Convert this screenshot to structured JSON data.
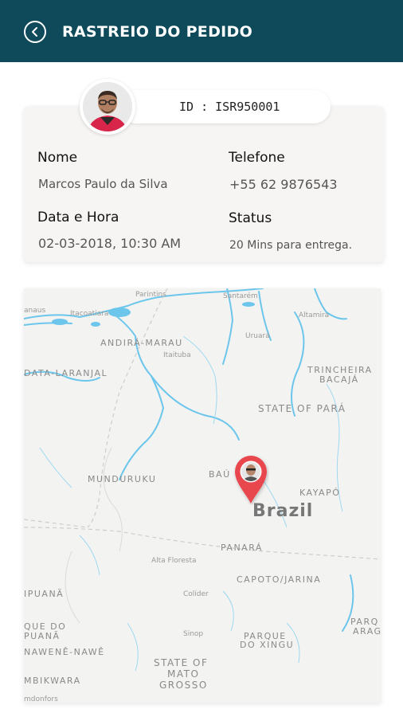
{
  "header": {
    "title": "RASTREIO DO PEDIDO"
  },
  "order": {
    "id_text": "ID : ISR950001"
  },
  "details": {
    "name_label": "Nome",
    "name_value": "Marcos Paulo da Silva",
    "phone_label": "Telefone",
    "phone_value": "+55 62 9876543",
    "datetime_label": "Data e Hora",
    "datetime_value": "02-03-2018, 10:30 AM",
    "status_label": "Status",
    "status_value": "20 Mins para entrega."
  },
  "map": {
    "labels": {
      "manaus": "anaus",
      "itacoatiara": "Itacoatiara",
      "parintins": "Parintins",
      "santarem": "Santarém",
      "altamira": "Altamira",
      "andira_marau": "ANDIRÁ-MARAU",
      "itaituba": "Itaituba",
      "uruara": "Uruará",
      "data_laranjal": "DATA-LARANJAL",
      "trincheira_bacaja_1": "TRINCHEIRA",
      "trincheira_bacaja_2": "BACAJÁ",
      "state_of_para": "STATE OF PARÁ",
      "munduruku": "MUNDURUKU",
      "bau": "BAÚ",
      "kayapo": "KAYAPÓ",
      "brazil": "Brazil",
      "panara": "PANARÁ",
      "alta_floresta": "Alta Floresta",
      "capoto_jarina": "CAPOTO/JARINA",
      "ipuana": "IPUANÃ",
      "colider": "Colíder",
      "que_do_1": "QUE DO",
      "que_do_2": "PUANÃ",
      "sinop": "Sinop",
      "parque_xingu_1": "PARQUE",
      "parque_xingu_2": "DO XINGU",
      "parq_arag_1": "PARQ",
      "parq_arag_2": "ARAG",
      "nawene_nawe": "NAWENÊ-NAWÊ",
      "state_of_mato_grosso_1": "STATE OF",
      "state_of_mato_grosso_2": "MATO",
      "state_of_mato_grosso_3": "GROSSO",
      "mbikwara": "MBIKWARA",
      "mdonfors": "mdonfors"
    },
    "pin_color": "#e8474e"
  },
  "colors": {
    "header_bg": "#0e4a5a",
    "water": "#6cc6ec"
  },
  "icons": {
    "back": "chevron-left-circle-icon",
    "pin": "map-pin-icon"
  }
}
